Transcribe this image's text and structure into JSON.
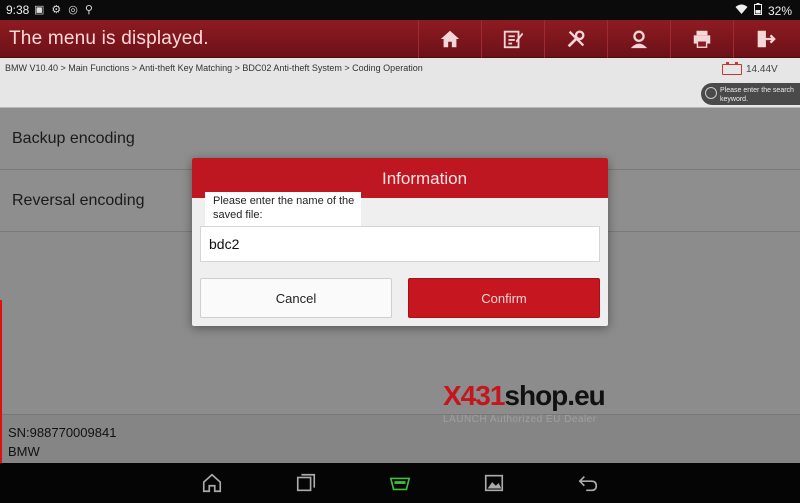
{
  "statusbar": {
    "time": "9:38",
    "battery": "32%"
  },
  "app": {
    "title": "The menu is displayed."
  },
  "toolbar": {
    "icons": [
      "home-icon",
      "notes-icon",
      "tools-icon",
      "user-icon",
      "print-icon",
      "exit-icon"
    ]
  },
  "breadcrumb": "BMW V10.40 > Main Functions > Anti-theft Key Matching > BDC02 Anti-theft System > Coding Operation",
  "voltage": "14.44V",
  "search": {
    "placeholder": "Please enter the search keyword."
  },
  "menu": [
    {
      "label": "Backup encoding"
    },
    {
      "label": "Reversal encoding"
    }
  ],
  "footer": {
    "serial": "SN:988770009841",
    "vehicle": "BMW"
  },
  "watermark": {
    "brand_red": "X431",
    "brand_dark": "shop.eu",
    "tagline": "LAUNCH Authorized EU Dealer"
  },
  "dialog": {
    "title": "Information",
    "prompt": "Please enter the name of the saved file:",
    "input_value": "bdc2",
    "cancel_label": "Cancel",
    "confirm_label": "Confirm"
  },
  "colors": {
    "brand_red": "#bf1721",
    "header_red": "#7d151c"
  }
}
